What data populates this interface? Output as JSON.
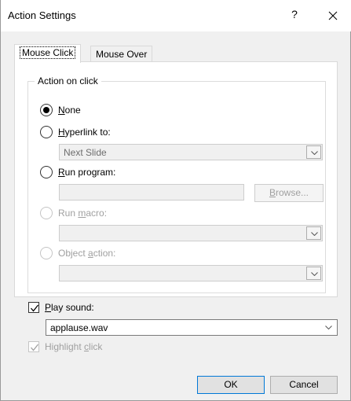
{
  "window": {
    "title": "Action Settings",
    "help_glyph": "?"
  },
  "tabs": [
    {
      "label": "Mouse Click",
      "active": true
    },
    {
      "label": "Mouse Over",
      "active": false
    }
  ],
  "group": {
    "label": "Action on click"
  },
  "options": {
    "none": {
      "label_u": "N",
      "label_rest": "one",
      "checked": true
    },
    "hyperlink": {
      "label_u": "H",
      "label_rest": "yperlink to:",
      "checked": false,
      "value": "Next Slide"
    },
    "run_program": {
      "label_u": "R",
      "label_rest": "un program:",
      "checked": false,
      "value": "",
      "browse_pre": "",
      "browse_u": "B",
      "browse_rest": "rowse..."
    },
    "run_macro": {
      "label_pre": "Run ",
      "label_u": "m",
      "label_rest": "acro:",
      "disabled": true,
      "value": ""
    },
    "object_action": {
      "label_pre": "Object ",
      "label_u": "a",
      "label_rest": "ction:",
      "disabled": true,
      "value": ""
    }
  },
  "play_sound": {
    "label_u": "P",
    "label_rest": "lay sound:",
    "checked": true,
    "value": "applause.wav"
  },
  "highlight_click": {
    "label_pre": "Highlight ",
    "label_u": "c",
    "label_rest": "lick",
    "checked": true,
    "disabled": true
  },
  "buttons": {
    "ok": "OK",
    "cancel": "Cancel"
  },
  "colors": {
    "accent": "#0078d7",
    "disabled_text": "#a0a0a0"
  }
}
